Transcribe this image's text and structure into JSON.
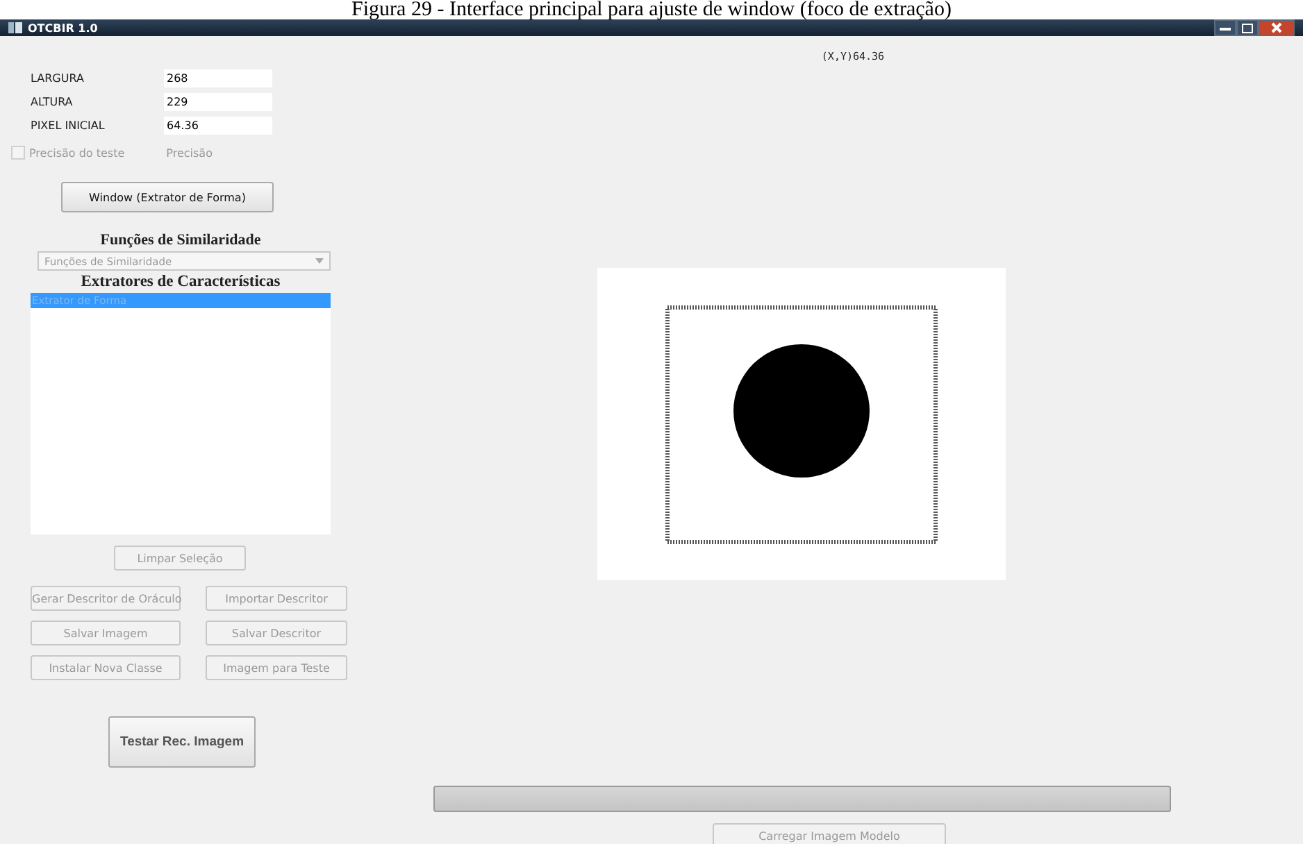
{
  "caption": "Figura 29 - Interface principal para ajuste de window (foco de extração)",
  "window": {
    "title": "OTCBIR 1.0"
  },
  "fields": [
    {
      "label": "LARGURA",
      "value": "268"
    },
    {
      "label": "ALTURA",
      "value": "229"
    },
    {
      "label": "PIXEL INICIAL",
      "value": "64.36"
    }
  ],
  "precision_checkbox": {
    "label": "Precisão do teste",
    "checked": false,
    "disabled": true
  },
  "precision_label": "Precisão",
  "window_button": {
    "label": "Window (Extrator de Forma)",
    "disabled": false
  },
  "similarity": {
    "heading": "Funções de Similaridade",
    "dropdown": {
      "value": "Funções de Similaridade",
      "disabled": true
    }
  },
  "extractors": {
    "heading": "Extratores de Características",
    "items": [
      {
        "label": "Extrator de Forma",
        "selected": true
      }
    ]
  },
  "clear_button": {
    "label": "Limpar Seleção",
    "disabled": true
  },
  "action_buttons": [
    {
      "label": "Gerar Descritor de Oráculo",
      "disabled": true
    },
    {
      "label": "Importar Descritor",
      "disabled": true
    },
    {
      "label": "Salvar Imagem",
      "disabled": true
    },
    {
      "label": "Salvar Descritor",
      "disabled": true
    },
    {
      "label": "Instalar Nova Classe",
      "disabled": true
    },
    {
      "label": "Imagem para Teste",
      "disabled": true
    }
  ],
  "test_button": {
    "label": "Testar Rec. Imagem",
    "disabled": false
  },
  "coordinates": "(X,Y)64.36",
  "image_view": {
    "kind": "shape",
    "window_frame": true
  },
  "progress": {
    "level": 0
  },
  "load_button": {
    "label": "Carregar  Imagem Modelo",
    "disabled": true
  }
}
